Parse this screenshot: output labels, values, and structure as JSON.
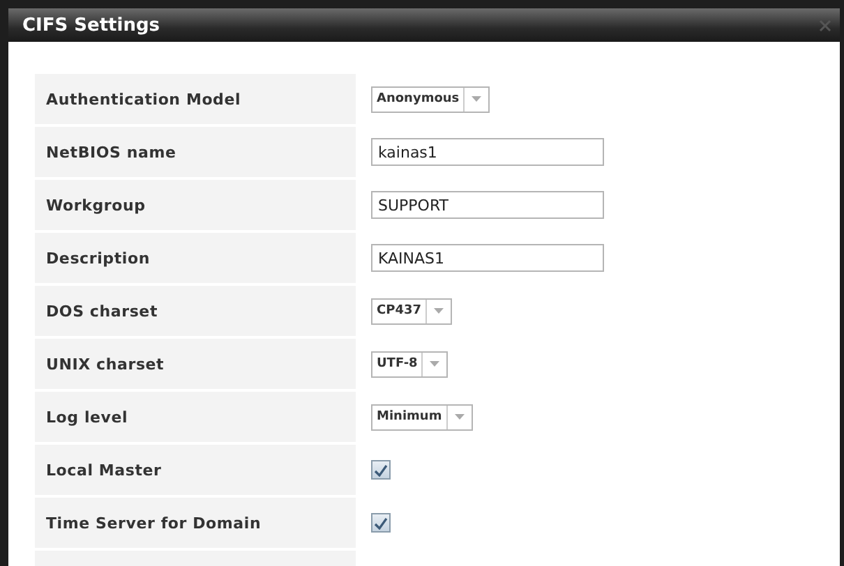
{
  "window": {
    "title": "CIFS Settings"
  },
  "fields": [
    {
      "label": "Authentication Model",
      "kind": "select",
      "value": "Anonymous"
    },
    {
      "label": "NetBIOS name",
      "kind": "text",
      "value": "kainas1"
    },
    {
      "label": "Workgroup",
      "kind": "text",
      "value": "SUPPORT"
    },
    {
      "label": "Description",
      "kind": "text",
      "value": "KAINAS1"
    },
    {
      "label": "DOS charset",
      "kind": "select",
      "value": "CP437"
    },
    {
      "label": "UNIX charset",
      "kind": "select",
      "value": "UTF-8"
    },
    {
      "label": "Log level",
      "kind": "select",
      "value": "Minimum"
    },
    {
      "label": "Local Master",
      "kind": "checkbox",
      "checked": true
    },
    {
      "label": "Time Server for Domain",
      "kind": "checkbox",
      "checked": true
    }
  ]
}
